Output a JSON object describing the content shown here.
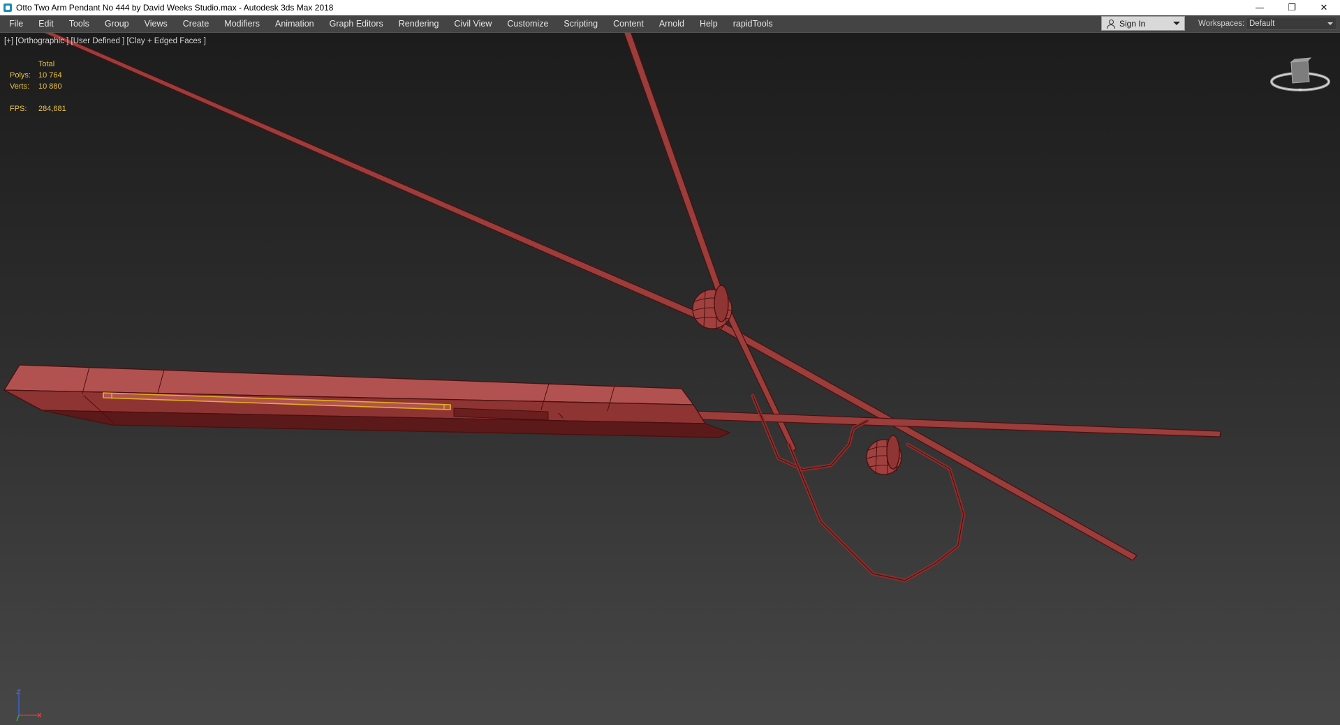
{
  "window": {
    "title": "Otto Two Arm Pendant No 444 by David Weeks Studio.max - Autodesk 3ds Max 2018",
    "app_icon": "3ds-max-icon",
    "controls": {
      "minimize": "—",
      "restore": "❐",
      "close": "✕"
    }
  },
  "menubar": {
    "items": [
      "File",
      "Edit",
      "Tools",
      "Group",
      "Views",
      "Create",
      "Modifiers",
      "Animation",
      "Graph Editors",
      "Rendering",
      "Civil View",
      "Customize",
      "Scripting",
      "Content",
      "Arnold",
      "Help",
      "rapidTools"
    ]
  },
  "account": {
    "sign_in_label": "Sign In",
    "icon": "user-icon"
  },
  "workspaces": {
    "label": "Workspaces:",
    "value": "Default"
  },
  "viewport": {
    "label": "[+] [Orthographic ] [User Defined ] [Clay + Edged Faces ]",
    "stats": {
      "header": "Total",
      "polys_label": "Polys:",
      "polys_value": "10 764",
      "verts_label": "Verts:",
      "verts_value": "10 880",
      "fps_label": "FPS:",
      "fps_value": "284,681"
    },
    "viewcube_icon": "viewcube-icon",
    "axis_icon": "axis-tripod-icon"
  },
  "colors": {
    "model_fill": "#a0413f",
    "model_edge": "#4a0f0f",
    "selection": "#e0b020",
    "stats_text": "#e8c24a"
  }
}
